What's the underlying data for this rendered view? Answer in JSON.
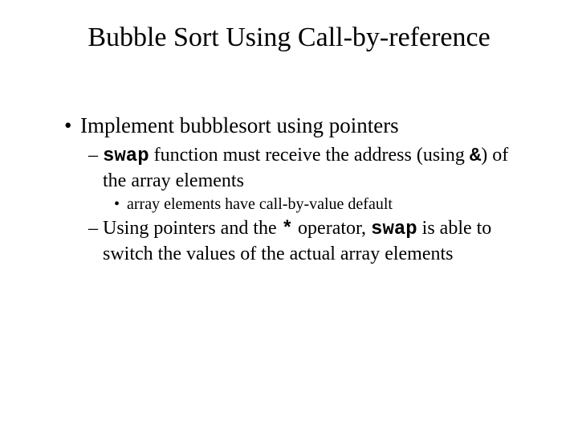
{
  "title": "Bubble Sort Using Call-by-reference",
  "b1": "Implement bubblesort using pointers",
  "b2a": "swap",
  "b2b": " function must receive the address (using ",
  "b2c": "&",
  "b2d": ") of the array elements",
  "b3": "array elements have call-by-value default",
  "b4a": "Using pointers and the ",
  "b4b": "*",
  "b4c": " operator, ",
  "b4d": "swap",
  "b4e": " is able to switch the values of the actual array elements"
}
